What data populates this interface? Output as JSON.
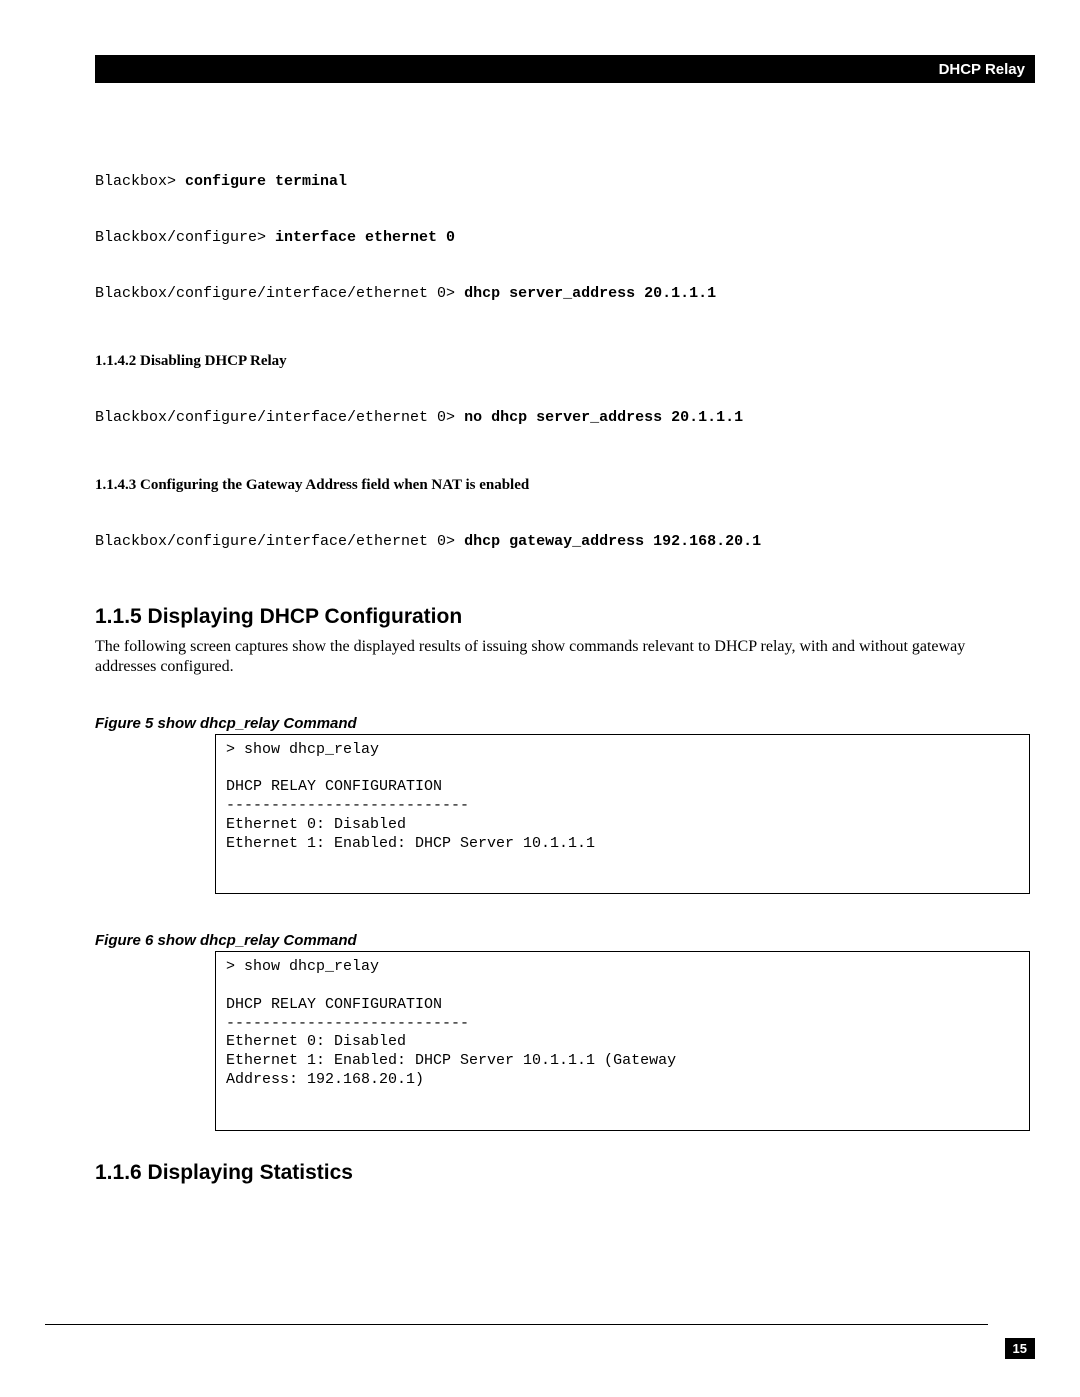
{
  "header": {
    "title": "DHCP Relay"
  },
  "terminal": {
    "line1_prompt": "Blackbox> ",
    "line1_cmd": "configure terminal",
    "line2_prompt": "Blackbox/configure> ",
    "line2_cmd": "interface ethernet 0",
    "line3_prompt": "Blackbox/configure/interface/ethernet 0> ",
    "line3_cmd": "dhcp server_address 20.1.1.1"
  },
  "section_1142": {
    "heading": "1.1.4.2  Disabling DHCP Relay",
    "line_prompt": "Blackbox/configure/interface/ethernet 0> ",
    "line_cmd": "no dhcp server_address 20.1.1.1"
  },
  "section_1143": {
    "heading": "1.1.4.3  Configuring the Gateway Address field when NAT is enabled",
    "line_prompt": "Blackbox/configure/interface/ethernet 0> ",
    "line_cmd": "dhcp gateway_address 192.168.20.1"
  },
  "section_115": {
    "heading": "1.1.5 Displaying DHCP Configuration",
    "body": "The following screen captures show the displayed results of issuing show commands relevant to DHCP relay, with and without gateway addresses configured."
  },
  "figure5": {
    "caption": "Figure 5  show dhcp_relay Command",
    "content": "> show dhcp_relay\n\nDHCP RELAY CONFIGURATION\n---------------------------\nEthernet 0: Disabled\nEthernet 1: Enabled: DHCP Server 10.1.1.1"
  },
  "figure6": {
    "caption": "Figure 6  show dhcp_relay Command",
    "content": "> show dhcp_relay\n\nDHCP RELAY CONFIGURATION\n---------------------------\nEthernet 0: Disabled\nEthernet 1: Enabled: DHCP Server 10.1.1.1 (Gateway \nAddress: 192.168.20.1)"
  },
  "section_116": {
    "heading": "1.1.6 Displaying Statistics"
  },
  "footer": {
    "page": "15"
  }
}
